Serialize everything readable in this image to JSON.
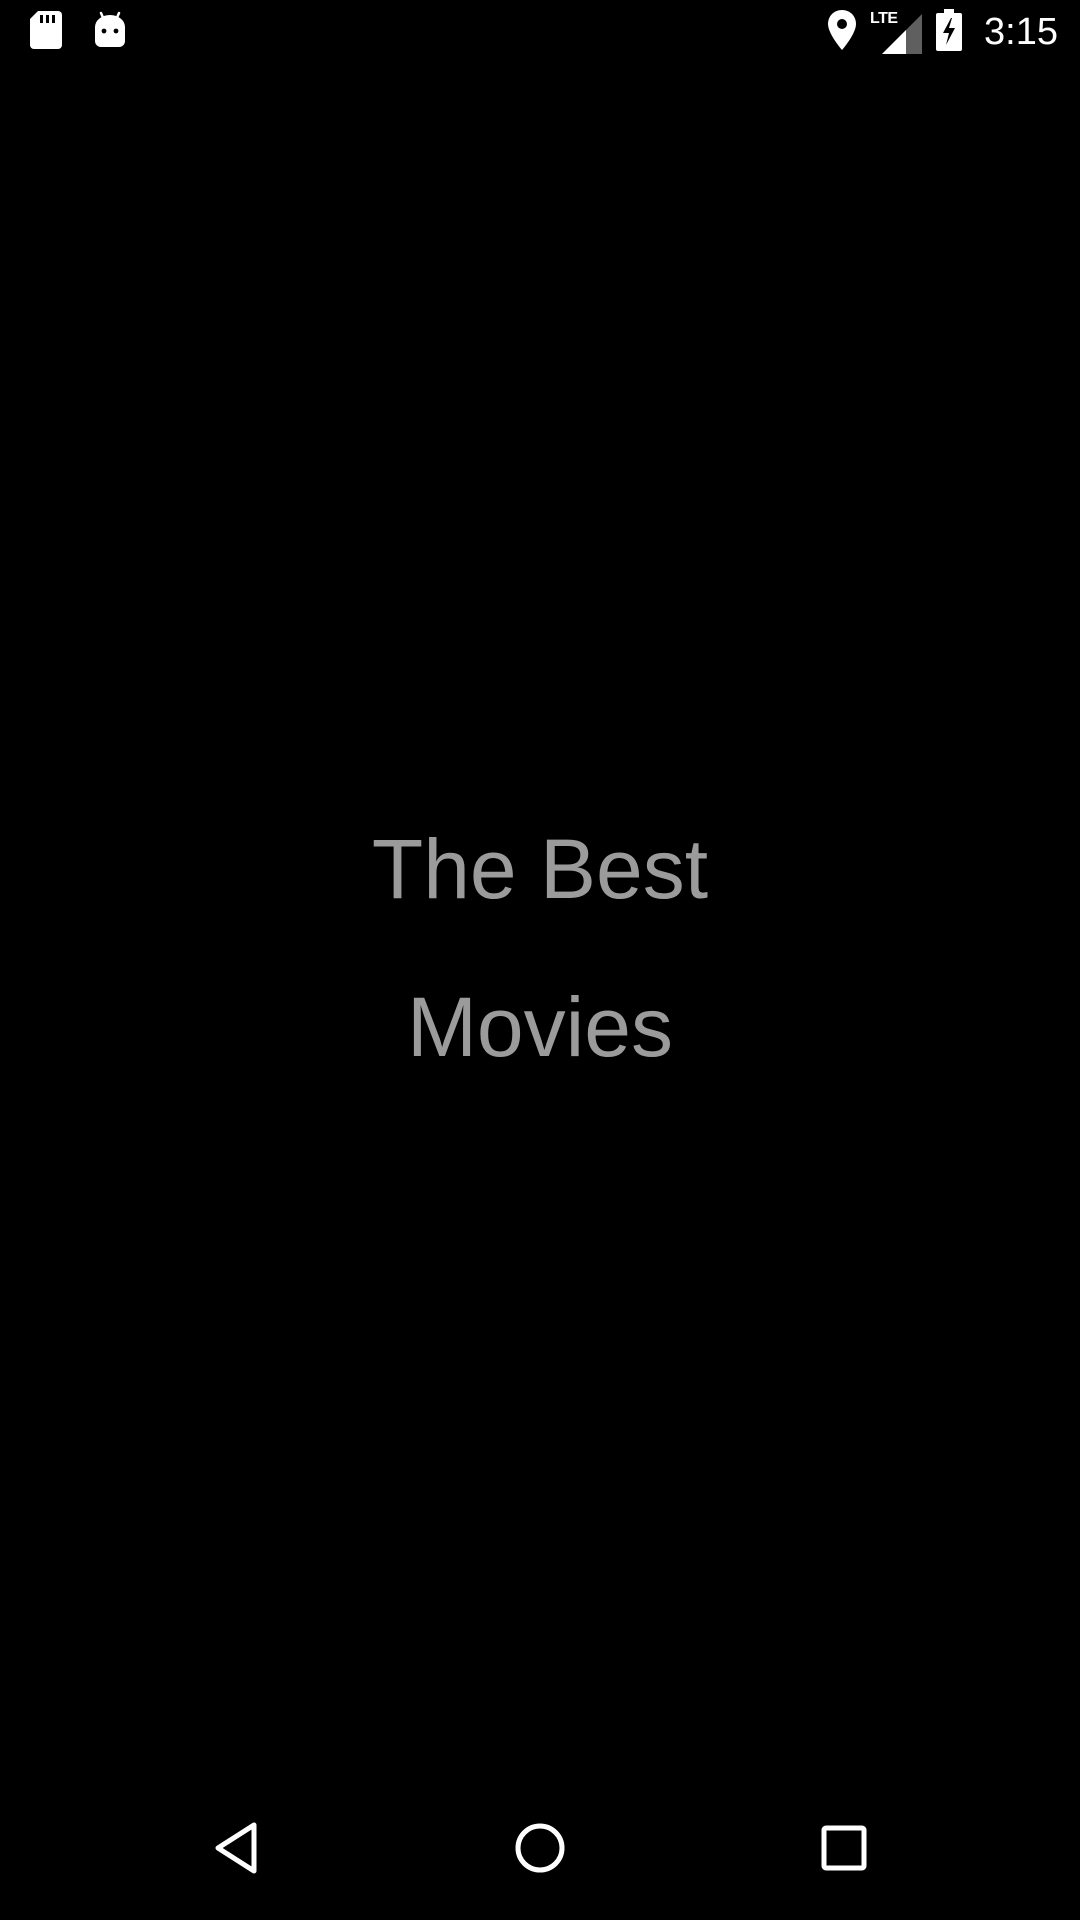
{
  "status_bar": {
    "left_icons": [
      "sd-card-icon",
      "android-debug-icon"
    ],
    "right_icons": [
      "location-icon",
      "signal-icon",
      "battery-charging-icon"
    ],
    "network_label": "LTE",
    "time": "3:15"
  },
  "splash": {
    "line1": "The Best",
    "line2": "Movies"
  },
  "nav_bar": {
    "buttons": [
      "back-icon",
      "home-icon",
      "recents-icon"
    ]
  },
  "colors": {
    "background": "#000000",
    "splash_text": "#9b9b9b",
    "status_icons": "#ffffff"
  }
}
